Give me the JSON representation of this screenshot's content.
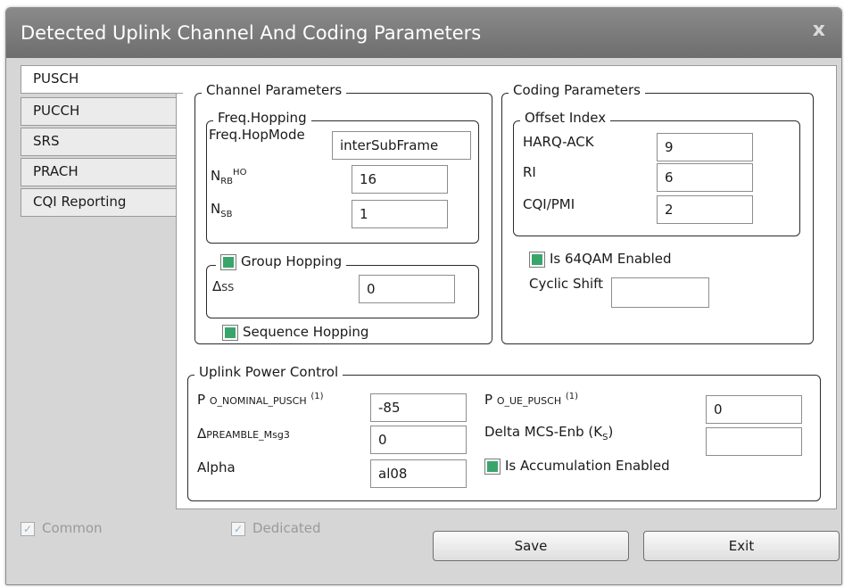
{
  "window": {
    "title": "Detected Uplink Channel And Coding Parameters",
    "close_glyph": "x"
  },
  "tabs": [
    {
      "label": "PUSCH"
    },
    {
      "label": "PUCCH"
    },
    {
      "label": "SRS"
    },
    {
      "label": "PRACH"
    },
    {
      "label": "CQI Reporting"
    }
  ],
  "channel": {
    "legend": "Channel Parameters",
    "freq_hopping": {
      "legend": "Freq.Hopping",
      "hop_mode_label": "Freq.HopMode",
      "hop_mode_value": "interSubFrame",
      "nrb_label_main": "N",
      "nrb_label_sub": "RB",
      "nrb_label_sup": "HO",
      "nrb_value": "16",
      "nsb_label_main": "N",
      "nsb_label_sub": "SB",
      "nsb_value": "1"
    },
    "group_hopping": {
      "label": "Group Hopping",
      "delta_main": "Δ",
      "delta_sub": "SS",
      "delta_value": "0"
    },
    "sequence_hopping_label": "Sequence Hopping"
  },
  "coding": {
    "legend": "Coding Parameters",
    "offset": {
      "legend": "Offset Index",
      "harq_label": "HARQ-ACK",
      "harq_value": "9",
      "ri_label": "RI",
      "ri_value": "6",
      "cqi_label": "CQI/PMI",
      "cqi_value": "2"
    },
    "qam_label": "Is 64QAM Enabled",
    "cyclic_shift_label": "Cyclic Shift",
    "cyclic_shift_value": ""
  },
  "power": {
    "legend": "Uplink Power Control",
    "p_nominal_main": "P",
    "p_nominal_sub": "O_NOMINAL_PUSCH",
    "p_nominal_sup": "(1)",
    "p_nominal_value": "-85",
    "delta_preamble_main": "Δ",
    "delta_preamble_sub": "PREAMBLE_Msg3",
    "delta_preamble_value": "0",
    "alpha_label": "Alpha",
    "alpha_value": "al08",
    "p_ue_main": "P",
    "p_ue_sub": "O_UE_PUSCH",
    "p_ue_sup": "(1)",
    "p_ue_value": "0",
    "delta_mcs_label": "Delta MCS-Enb (K",
    "delta_mcs_sub": "S",
    "delta_mcs_close": ")",
    "delta_mcs_value": "",
    "accumulation_label": "Is Accumulation Enabled"
  },
  "footer": {
    "common_label": "Common",
    "dedicated_label": "Dedicated",
    "check_glyph": "✓",
    "save_label": "Save",
    "exit_label": "Exit"
  },
  "colors": {
    "titlebar": "#7a7a7a",
    "check_green": "#3aa56b",
    "window_bg": "#d6d6d6"
  }
}
